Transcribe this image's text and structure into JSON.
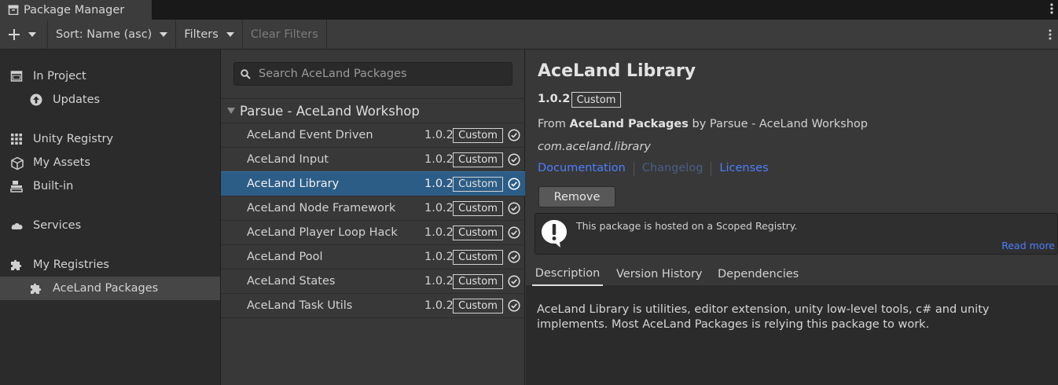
{
  "window": {
    "title": "Package Manager"
  },
  "toolbar": {
    "add_label": "+",
    "sort_label": "Sort: Name (asc)",
    "filters_label": "Filters",
    "clear_filters_label": "Clear Filters"
  },
  "sidebar": {
    "items": [
      {
        "label": "In Project",
        "icon": "window-icon"
      },
      {
        "label": "Updates",
        "icon": "arrow-up-circle-icon"
      },
      {
        "label": "Unity Registry",
        "icon": "grid-icon"
      },
      {
        "label": "My Assets",
        "icon": "cube-icon"
      },
      {
        "label": "Built-in",
        "icon": "stack-icon"
      },
      {
        "label": "Services",
        "icon": "cloud-icon"
      },
      {
        "label": "My Registries",
        "icon": "puzzle-icon"
      },
      {
        "label": "AceLand Packages",
        "icon": "puzzle-icon"
      }
    ]
  },
  "search": {
    "placeholder": "Search AceLand Packages"
  },
  "list": {
    "group_title": "Parsue - AceLand Workshop",
    "packages": [
      {
        "name": "AceLand Event Driven",
        "version": "1.0.2",
        "tag": "Custom"
      },
      {
        "name": "AceLand Input",
        "version": "1.0.2",
        "tag": "Custom"
      },
      {
        "name": "AceLand Library",
        "version": "1.0.2",
        "tag": "Custom",
        "selected": true
      },
      {
        "name": "AceLand Node Framework",
        "version": "1.0.2",
        "tag": "Custom"
      },
      {
        "name": "AceLand Player Loop Hack",
        "version": "1.0.2",
        "tag": "Custom"
      },
      {
        "name": "AceLand Pool",
        "version": "1.0.2",
        "tag": "Custom"
      },
      {
        "name": "AceLand States",
        "version": "1.0.2",
        "tag": "Custom"
      },
      {
        "name": "AceLand Task Utils",
        "version": "1.0.2",
        "tag": "Custom"
      }
    ]
  },
  "details": {
    "title": "AceLand Library",
    "version": "1.0.2",
    "tag": "Custom",
    "from_prefix": "From",
    "registry": "AceLand Packages",
    "by_text": "by Parsue - AceLand Workshop",
    "package_id": "com.aceland.library",
    "links": {
      "documentation": "Documentation",
      "changelog": "Changelog",
      "licenses": "Licenses"
    },
    "remove_label": "Remove",
    "notice_text": "This package is hosted on a Scoped Registry.",
    "read_more": "Read more",
    "tabs": {
      "description": "Description",
      "version_history": "Version History",
      "dependencies": "Dependencies"
    },
    "description": "AceLand Library is utilities, editor extension, unity low-level tools, c# and unity implements. Most AceLand Packages is relying this package to work."
  },
  "colors": {
    "selection": "#2c5d87",
    "link": "#4c7eff",
    "link_disabled": "#4a5f86",
    "panel_dark": "#2b2b2b",
    "panel": "#383838",
    "toolbar": "#3c3c3c"
  }
}
